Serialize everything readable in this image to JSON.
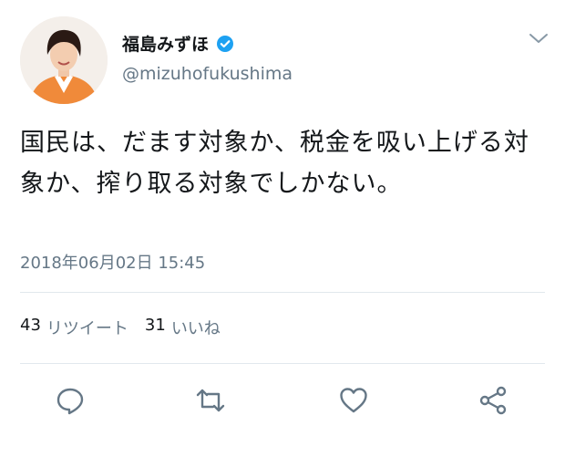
{
  "user": {
    "display_name": "福島みずほ",
    "handle": "@mizuhofukushima",
    "verified": true
  },
  "tweet": {
    "text": "国民は、だます対象か、税金を吸い上げる対象か、搾り取る対象でしかない。",
    "timestamp": "2018年06月02日 15:45"
  },
  "stats": {
    "retweets_count": "43",
    "retweets_label": "リツイート",
    "likes_count": "31",
    "likes_label": "いいね"
  },
  "icons": {
    "menu": "chevron-down-icon",
    "reply": "reply-icon",
    "retweet": "retweet-icon",
    "like": "heart-icon",
    "share": "share-icon",
    "verified": "verified-badge-icon"
  },
  "colors": {
    "verified_blue": "#1da1f2",
    "secondary_text": "#657786",
    "icon_gray": "#657786",
    "avatar_jacket": "#f08a3a"
  }
}
